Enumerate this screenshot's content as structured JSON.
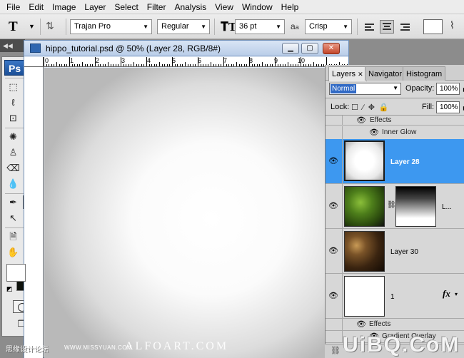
{
  "menu": [
    "File",
    "Edit",
    "Image",
    "Layer",
    "Select",
    "Filter",
    "Analysis",
    "View",
    "Window",
    "Help"
  ],
  "options": {
    "tool_glyph": "T",
    "font_family": "Trajan Pro",
    "font_style": "Regular",
    "font_size": "36 pt",
    "antialias_label": "a",
    "antialias_value": "Crisp"
  },
  "tools_panel": {
    "logo": "Ps"
  },
  "document": {
    "title": "hippo_tutorial.psd @ 50% (Layer 28, RGB/8#)",
    "ruler_labels": [
      "0",
      "1",
      "2",
      "3",
      "4",
      "5",
      "6",
      "7",
      "8",
      "9",
      "10"
    ]
  },
  "layers_panel": {
    "tabs": [
      "Layers",
      "Navigator",
      "Histogram"
    ],
    "blend_mode": "Normal",
    "opacity_label": "Opacity:",
    "opacity_value": "100%",
    "lock_label": "Lock:",
    "fill_label": "Fill:",
    "fill_value": "100%",
    "rows": {
      "effects_top": "Effects",
      "inner_glow": "Inner Glow",
      "layer28": "Layer 28",
      "masked": "L...",
      "layer30": "Layer 30",
      "layer1": "1",
      "effects_bottom": "Effects",
      "gradient_overlay": "Gradient Overlay"
    }
  },
  "watermarks": {
    "left_cn": "思缘设计论坛",
    "missyuan": "WWW.MISSYUAN.COM",
    "alfoart": "ALFOART.COM",
    "uibq": "UiBQ.CoM"
  }
}
